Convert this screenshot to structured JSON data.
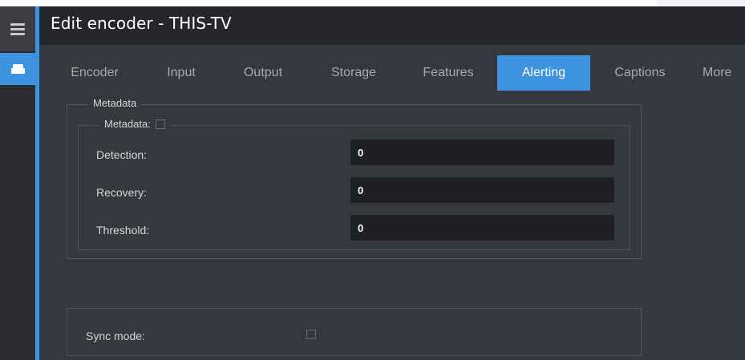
{
  "window": {
    "title": "Edit encoder - THIS-TV"
  },
  "rail": {
    "menu_icon": "hamburger-menu-icon",
    "active_item_icon": "drive-icon"
  },
  "tabs": [
    {
      "label": "Encoder",
      "active": false
    },
    {
      "label": "Input",
      "active": false
    },
    {
      "label": "Output",
      "active": false
    },
    {
      "label": "Storage",
      "active": false
    },
    {
      "label": "Features",
      "active": false
    },
    {
      "label": "Alerting",
      "active": true
    },
    {
      "label": "Captions",
      "active": false
    },
    {
      "label": "More",
      "active": false
    }
  ],
  "metadata_group": {
    "legend": "Metadata",
    "inner_legend": "Metadata:",
    "enabled": false,
    "fields": [
      {
        "label": "Detection:",
        "value": "0"
      },
      {
        "label": "Recovery:",
        "value": "0"
      },
      {
        "label": "Threshold:",
        "value": "0"
      }
    ]
  },
  "sync_group": {
    "label": "Sync mode:",
    "checked": false
  },
  "colors": {
    "accent": "#3d93e0",
    "panel": "#363840",
    "title_bar": "#25272c",
    "input_bg": "#1f2025"
  }
}
